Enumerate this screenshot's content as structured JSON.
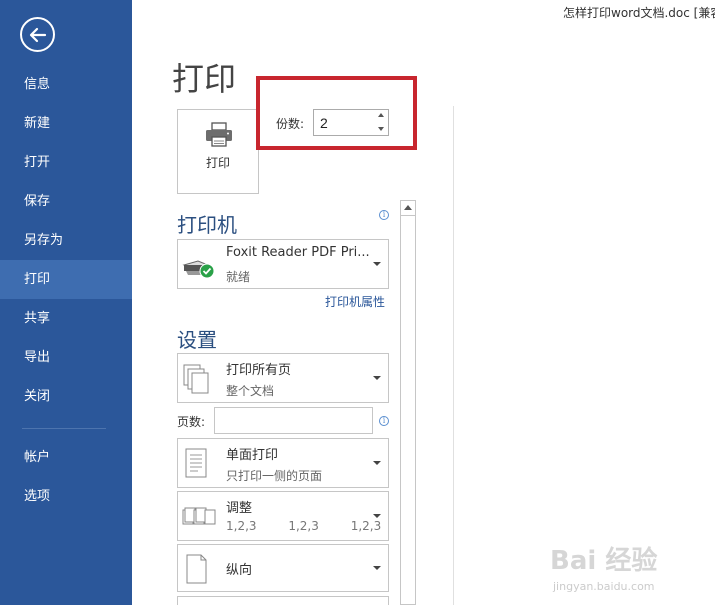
{
  "window": {
    "title": "怎样打印word文档.doc [兼容"
  },
  "sidebar": {
    "items": [
      {
        "label": "信息"
      },
      {
        "label": "新建"
      },
      {
        "label": "打开"
      },
      {
        "label": "保存"
      },
      {
        "label": "另存为"
      },
      {
        "label": "打印",
        "active": true
      },
      {
        "label": "共享"
      },
      {
        "label": "导出"
      },
      {
        "label": "关闭"
      },
      {
        "label": "帐户"
      },
      {
        "label": "选项"
      }
    ],
    "accent_color": "#2b579a",
    "active_color": "#3e6db0"
  },
  "main": {
    "title": "打印",
    "print_button_label": "打印",
    "copies": {
      "label": "份数:",
      "value": "2"
    },
    "printer": {
      "header": "打印机",
      "name": "Foxit Reader PDF Pri...",
      "status": "就绪",
      "properties_link": "打印机属性"
    },
    "settings": {
      "header": "设置",
      "page_range": {
        "title": "打印所有页",
        "subtitle": "整个文档"
      },
      "pages_label": "页数:",
      "pages_value": "",
      "sides": {
        "title": "单面打印",
        "subtitle": "只打印一侧的页面"
      },
      "collate": {
        "title": "调整",
        "subtitle": "1,2,3    1,2,3    1,2,3"
      },
      "orientation": {
        "title": "纵向"
      }
    }
  },
  "watermark": {
    "text": "Bai 经验",
    "sub": "jingyan.baidu.com"
  },
  "highlight_color": "#c8262e"
}
